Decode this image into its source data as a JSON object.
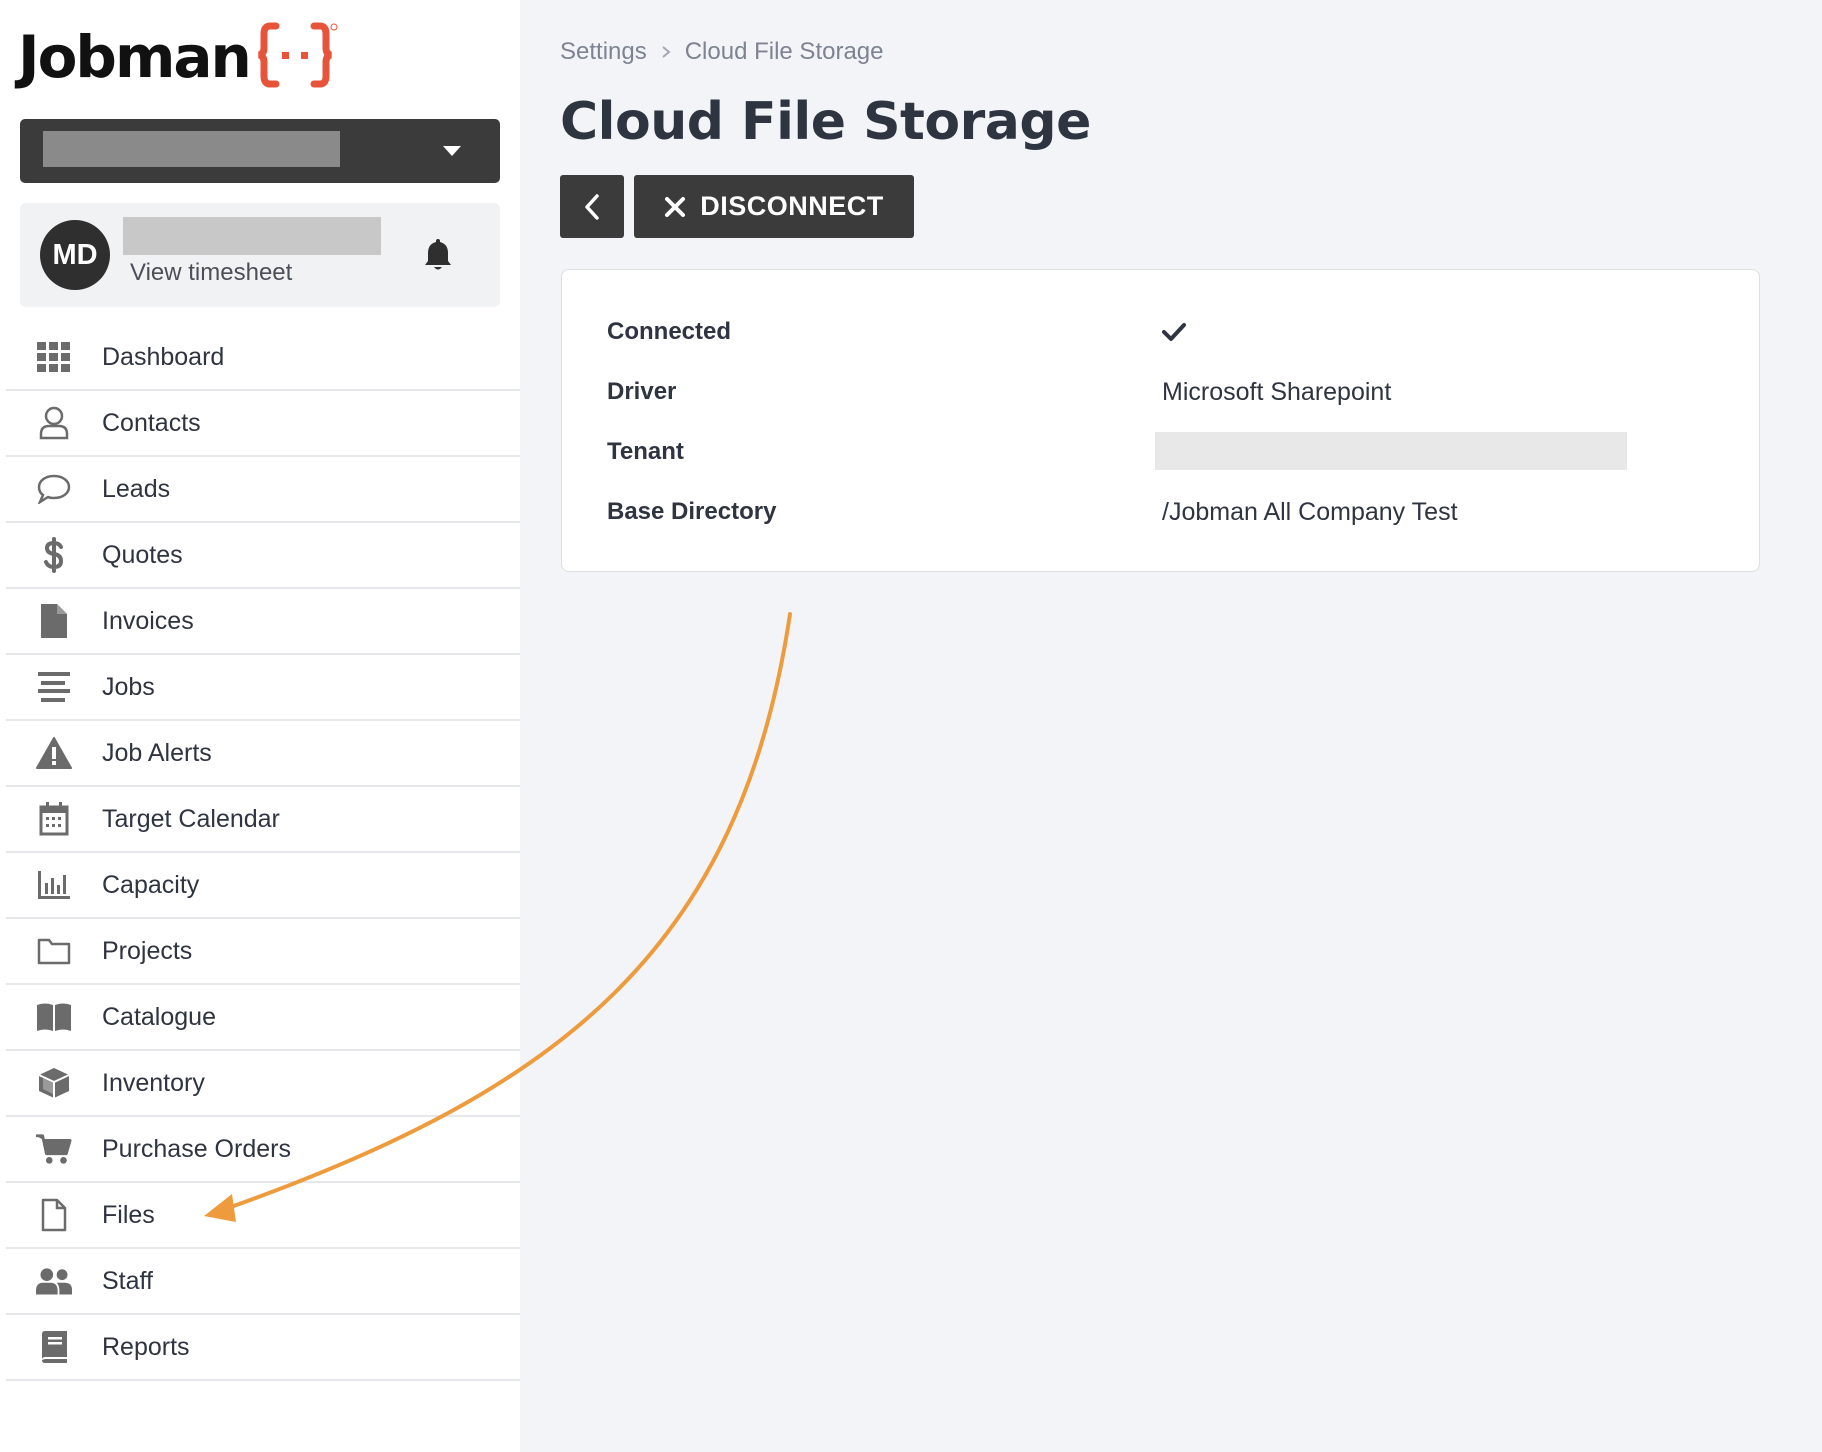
{
  "brand": {
    "name": "Jobman",
    "accent": "#e8543a"
  },
  "user": {
    "initials": "MD",
    "timesheet_link": "View timesheet"
  },
  "sidebar": {
    "items": [
      {
        "label": "Dashboard",
        "icon": "grid-icon"
      },
      {
        "label": "Contacts",
        "icon": "user-icon"
      },
      {
        "label": "Leads",
        "icon": "chat-bubble-icon"
      },
      {
        "label": "Quotes",
        "icon": "dollar-icon"
      },
      {
        "label": "Invoices",
        "icon": "document-icon"
      },
      {
        "label": "Jobs",
        "icon": "list-icon"
      },
      {
        "label": "Job Alerts",
        "icon": "warning-icon"
      },
      {
        "label": "Target Calendar",
        "icon": "calendar-icon"
      },
      {
        "label": "Capacity",
        "icon": "bar-chart-icon"
      },
      {
        "label": "Projects",
        "icon": "folder-icon"
      },
      {
        "label": "Catalogue",
        "icon": "book-open-icon"
      },
      {
        "label": "Inventory",
        "icon": "box-icon"
      },
      {
        "label": "Purchase Orders",
        "icon": "cart-icon"
      },
      {
        "label": "Files",
        "icon": "file-outline-icon"
      },
      {
        "label": "Staff",
        "icon": "users-icon"
      },
      {
        "label": "Reports",
        "icon": "report-book-icon"
      }
    ]
  },
  "breadcrumb": {
    "parent": "Settings",
    "current": "Cloud File Storage"
  },
  "page": {
    "title": "Cloud File Storage"
  },
  "toolbar": {
    "disconnect_label": "DISCONNECT"
  },
  "details": {
    "connected_label": "Connected",
    "driver_label": "Driver",
    "driver_value": "Microsoft Sharepoint",
    "tenant_label": "Tenant",
    "base_directory_label": "Base Directory",
    "base_directory_value": "/Jobman All Company Test"
  },
  "colors": {
    "dark_button": "#3b3b3b",
    "annotation_arrow": "#ed9b3c",
    "page_bg": "#f3f4f7"
  }
}
